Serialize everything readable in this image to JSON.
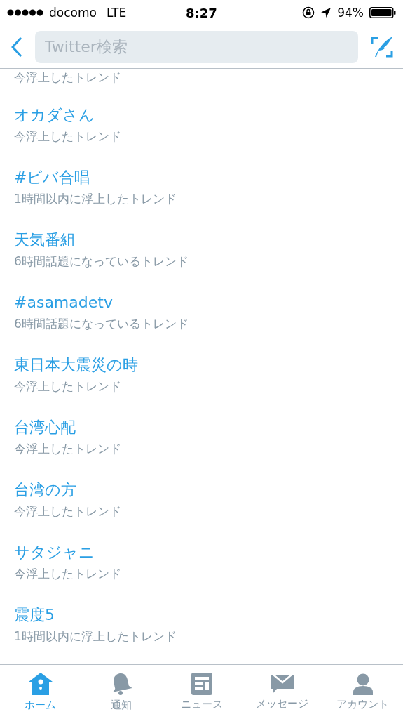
{
  "status_bar": {
    "carrier": "docomo",
    "network": "LTE",
    "time": "8:27",
    "battery": "94%"
  },
  "nav_bar": {
    "search": {
      "placeholder": "Twitter検索"
    }
  },
  "trends": {
    "partial_top": {
      "subtitle": "今浮上したトレンド"
    },
    "items": [
      {
        "title": "オカダさん",
        "subtitle": "今浮上したトレンド"
      },
      {
        "title": "#ビバ合唱",
        "subtitle": "1時間以内に浮上したトレンド"
      },
      {
        "title": "天気番組",
        "subtitle": "6時間話題になっているトレンド"
      },
      {
        "title": "#asamadetv",
        "subtitle": "6時間話題になっているトレンド"
      },
      {
        "title": "東日本大震災の時",
        "subtitle": "今浮上したトレンド"
      },
      {
        "title": "台湾心配",
        "subtitle": "今浮上したトレンド"
      },
      {
        "title": "台湾の方",
        "subtitle": "今浮上したトレンド"
      },
      {
        "title": "サタジャニ",
        "subtitle": "今浮上したトレンド"
      },
      {
        "title": "震度5",
        "subtitle": "1時間以内に浮上したトレンド"
      }
    ]
  },
  "tab_bar": {
    "tabs": [
      {
        "kind": "home",
        "label": "ホーム",
        "selected": true
      },
      {
        "kind": "bell",
        "label": "通知",
        "selected": false
      },
      {
        "kind": "news",
        "label": "ニュース",
        "selected": false
      },
      {
        "kind": "mail",
        "label": "メッセージ",
        "selected": false
      },
      {
        "kind": "person",
        "label": "アカウント",
        "selected": false
      }
    ]
  }
}
